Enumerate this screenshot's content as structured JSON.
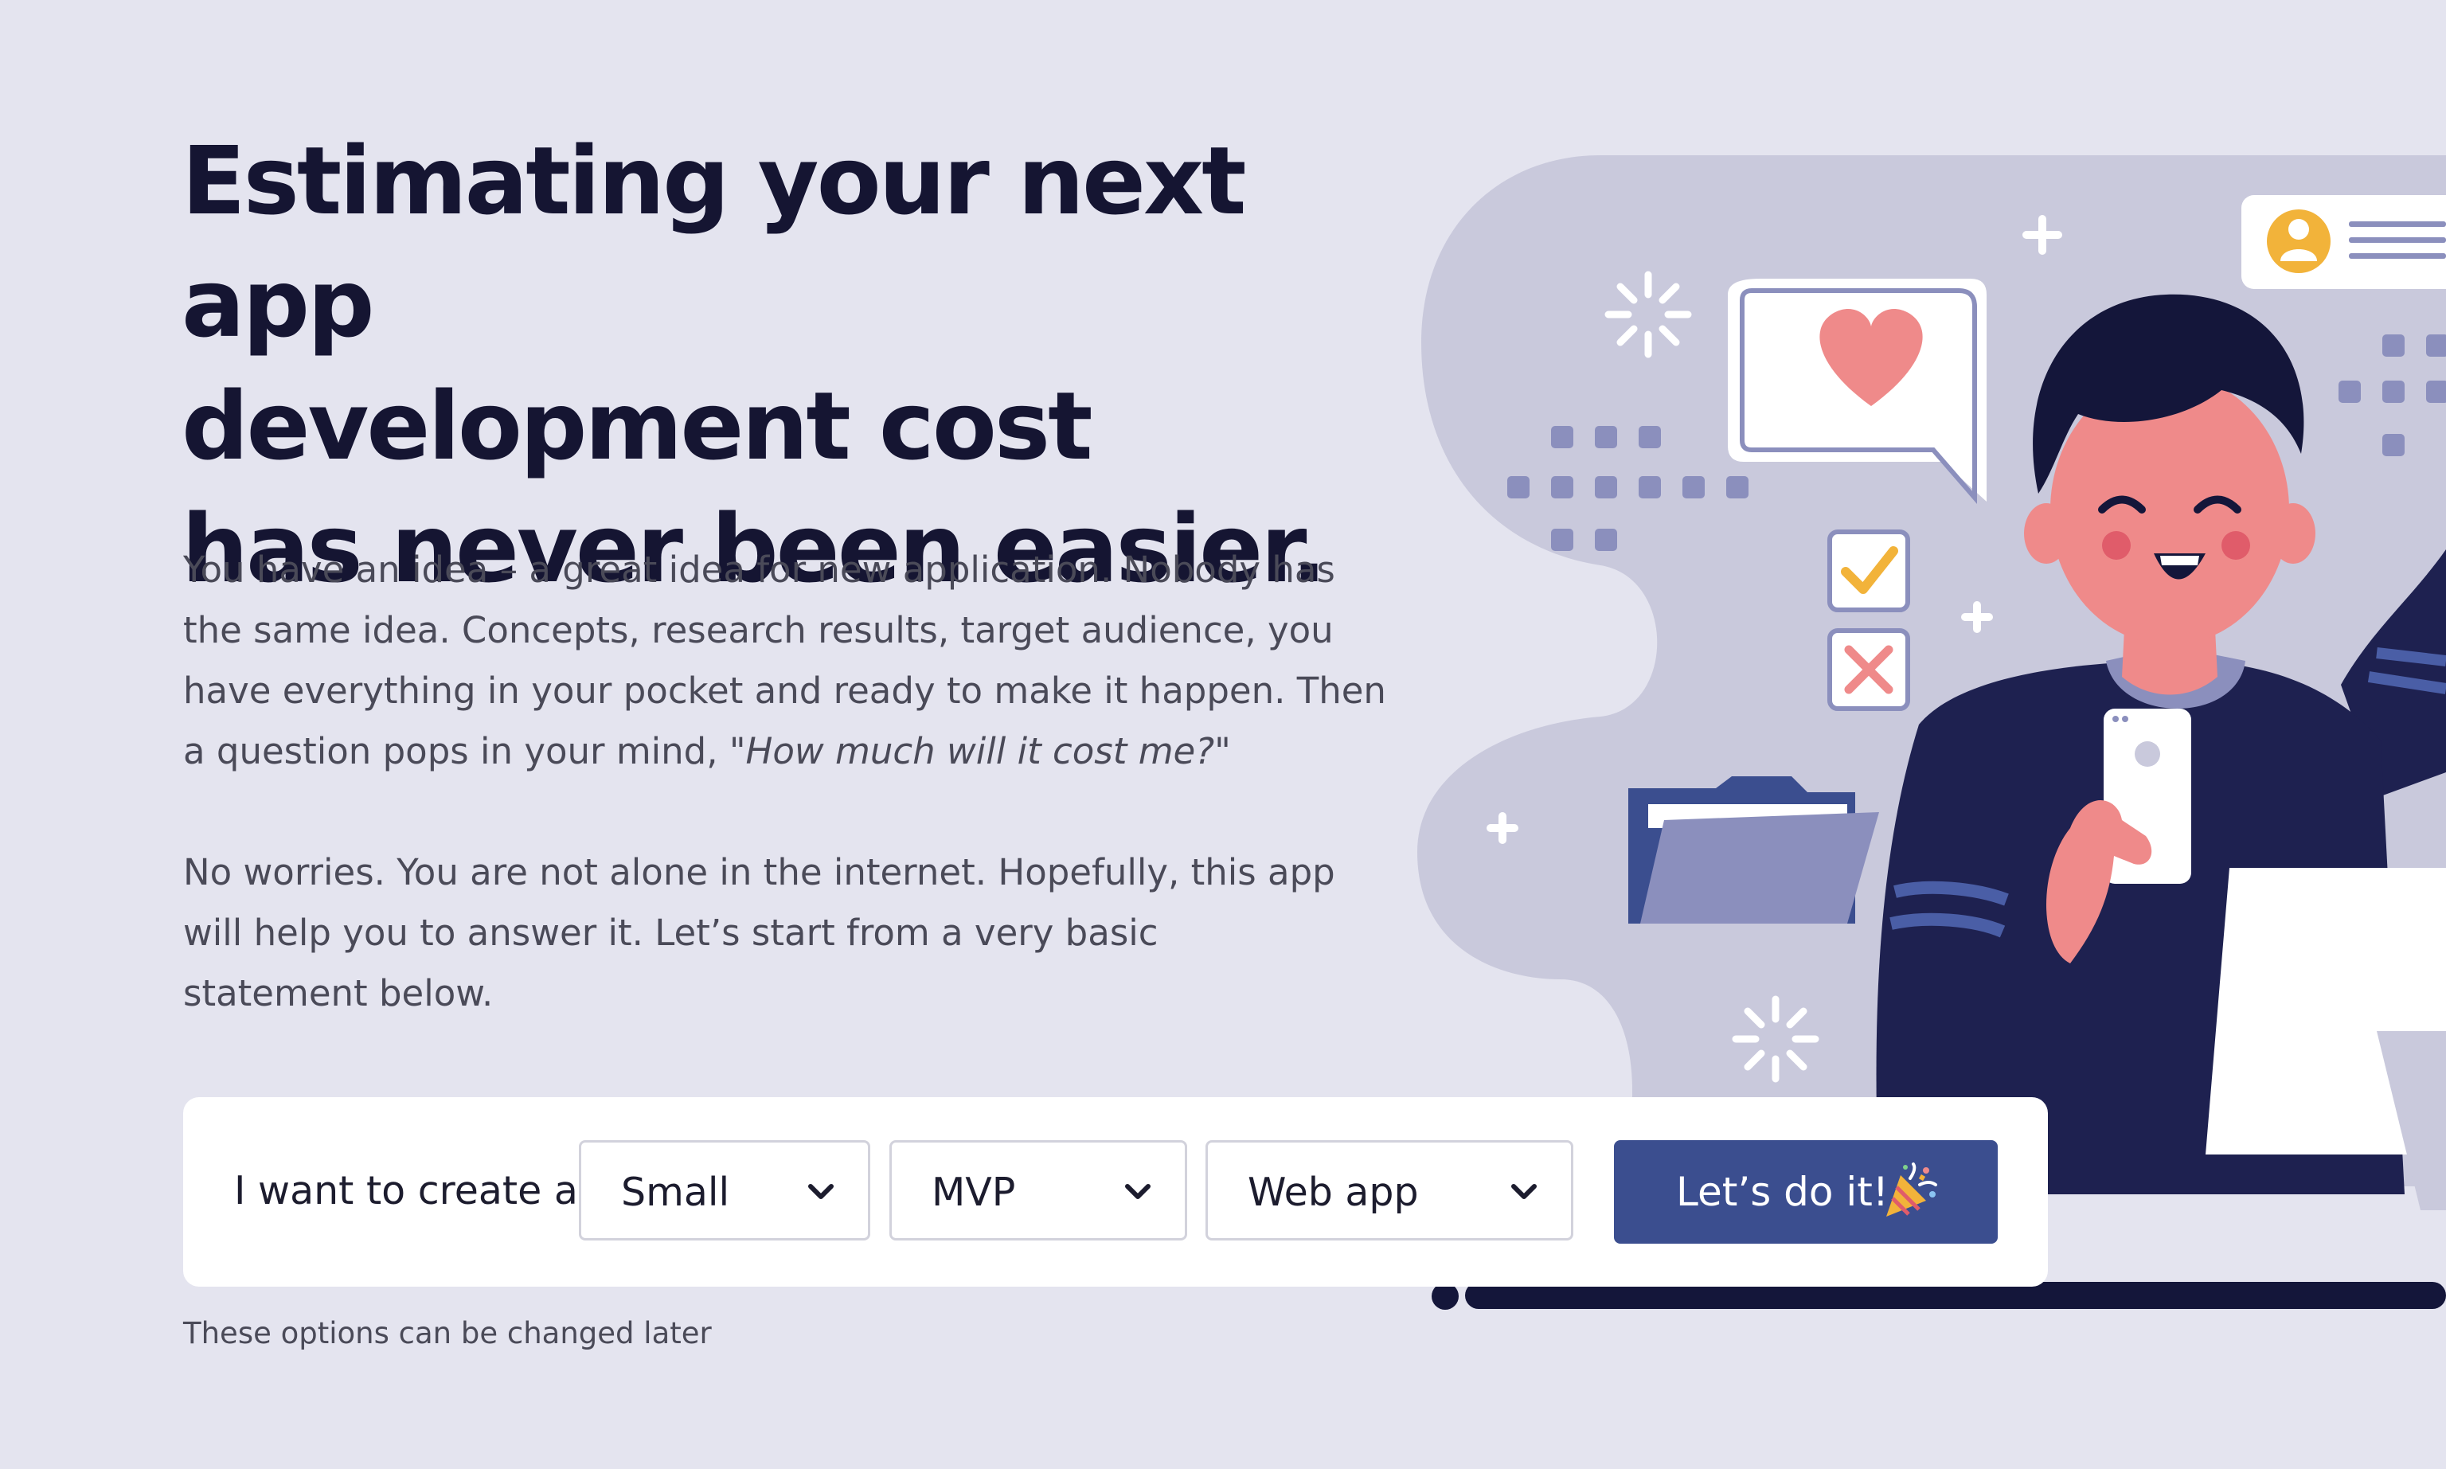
{
  "hero": {
    "title_lines": [
      "Estimating your next app",
      "development cost",
      "has never been easier."
    ]
  },
  "intro": {
    "paragraph1_text": "You have an idea – a great idea for new application. Nobody has the same idea. Concepts, research results, target audience, you have everything in your pocket and ready to make it happen. Then a question pops in your mind, ",
    "paragraph1_quote": "\"How much will it cost me?\"",
    "paragraph2": "No worries. You are not alone in the internet. Hopefully, this app will help you to answer it. Let’s start from a very basic statement below."
  },
  "form": {
    "lead": "I want to create a",
    "size_select": {
      "selected": "Small"
    },
    "stage_select": {
      "selected": "MVP"
    },
    "platform_select": {
      "selected": "Web app"
    },
    "submit_label": "Let’s do it!",
    "hint": "These options can be changed later"
  },
  "icons": {
    "select_arrow": "chevron-down-icon",
    "button_emoji": "party-popper-icon",
    "illustration": "person-with-phone-illustration"
  },
  "colors": {
    "background": "#e4e4ef",
    "primary_button": "#3b4e8f",
    "heading": "#151532",
    "body_text": "#4a4a58",
    "illustration_blob": "#c9c9dc",
    "accent_red": "#ef8a8a",
    "accent_yellow": "#f2b33a"
  }
}
